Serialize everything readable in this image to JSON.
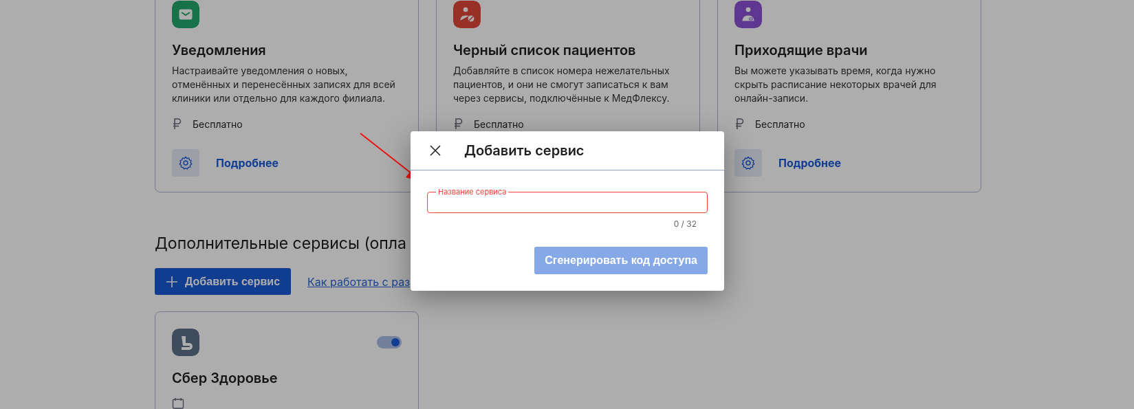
{
  "cards": [
    {
      "kind": "mail",
      "title": "Уведомления",
      "description": "Настраивайте уведомления о новых, отменённых и перенесённых записях для всей клиники или отдельно для каждого филиала.",
      "price": "Бесплатно",
      "link": "Подробнее"
    },
    {
      "kind": "blocked-user",
      "title": "Черный список пациентов",
      "description": "Добавляйте в список номера нежелательных пациентов, и они не смогут записаться к вам через сервисы, подключённые к МедФлексу.",
      "price": "Бесплатно"
    },
    {
      "kind": "doctor",
      "title": "Приходящие врачи",
      "description": "Вы можете указывать время, когда нужно скрыть расписание некоторых врачей для онлайн-записи.",
      "price": "Бесплатно",
      "link": "Подробнее"
    }
  ],
  "section": {
    "heading": "Дополнительные сервисы (опла",
    "add_button": "Добавить сервис",
    "help_link": "Как работать с раз"
  },
  "service_cards": [
    {
      "title": "Сбер Здоровье",
      "on": true
    }
  ],
  "dialog": {
    "title": "Добавить сервис",
    "field": {
      "label": "Название сервиса",
      "invalid": true,
      "counter": "0 / 32"
    },
    "submit": {
      "label": "Сгенерировать код доступа",
      "disabled": true
    }
  }
}
